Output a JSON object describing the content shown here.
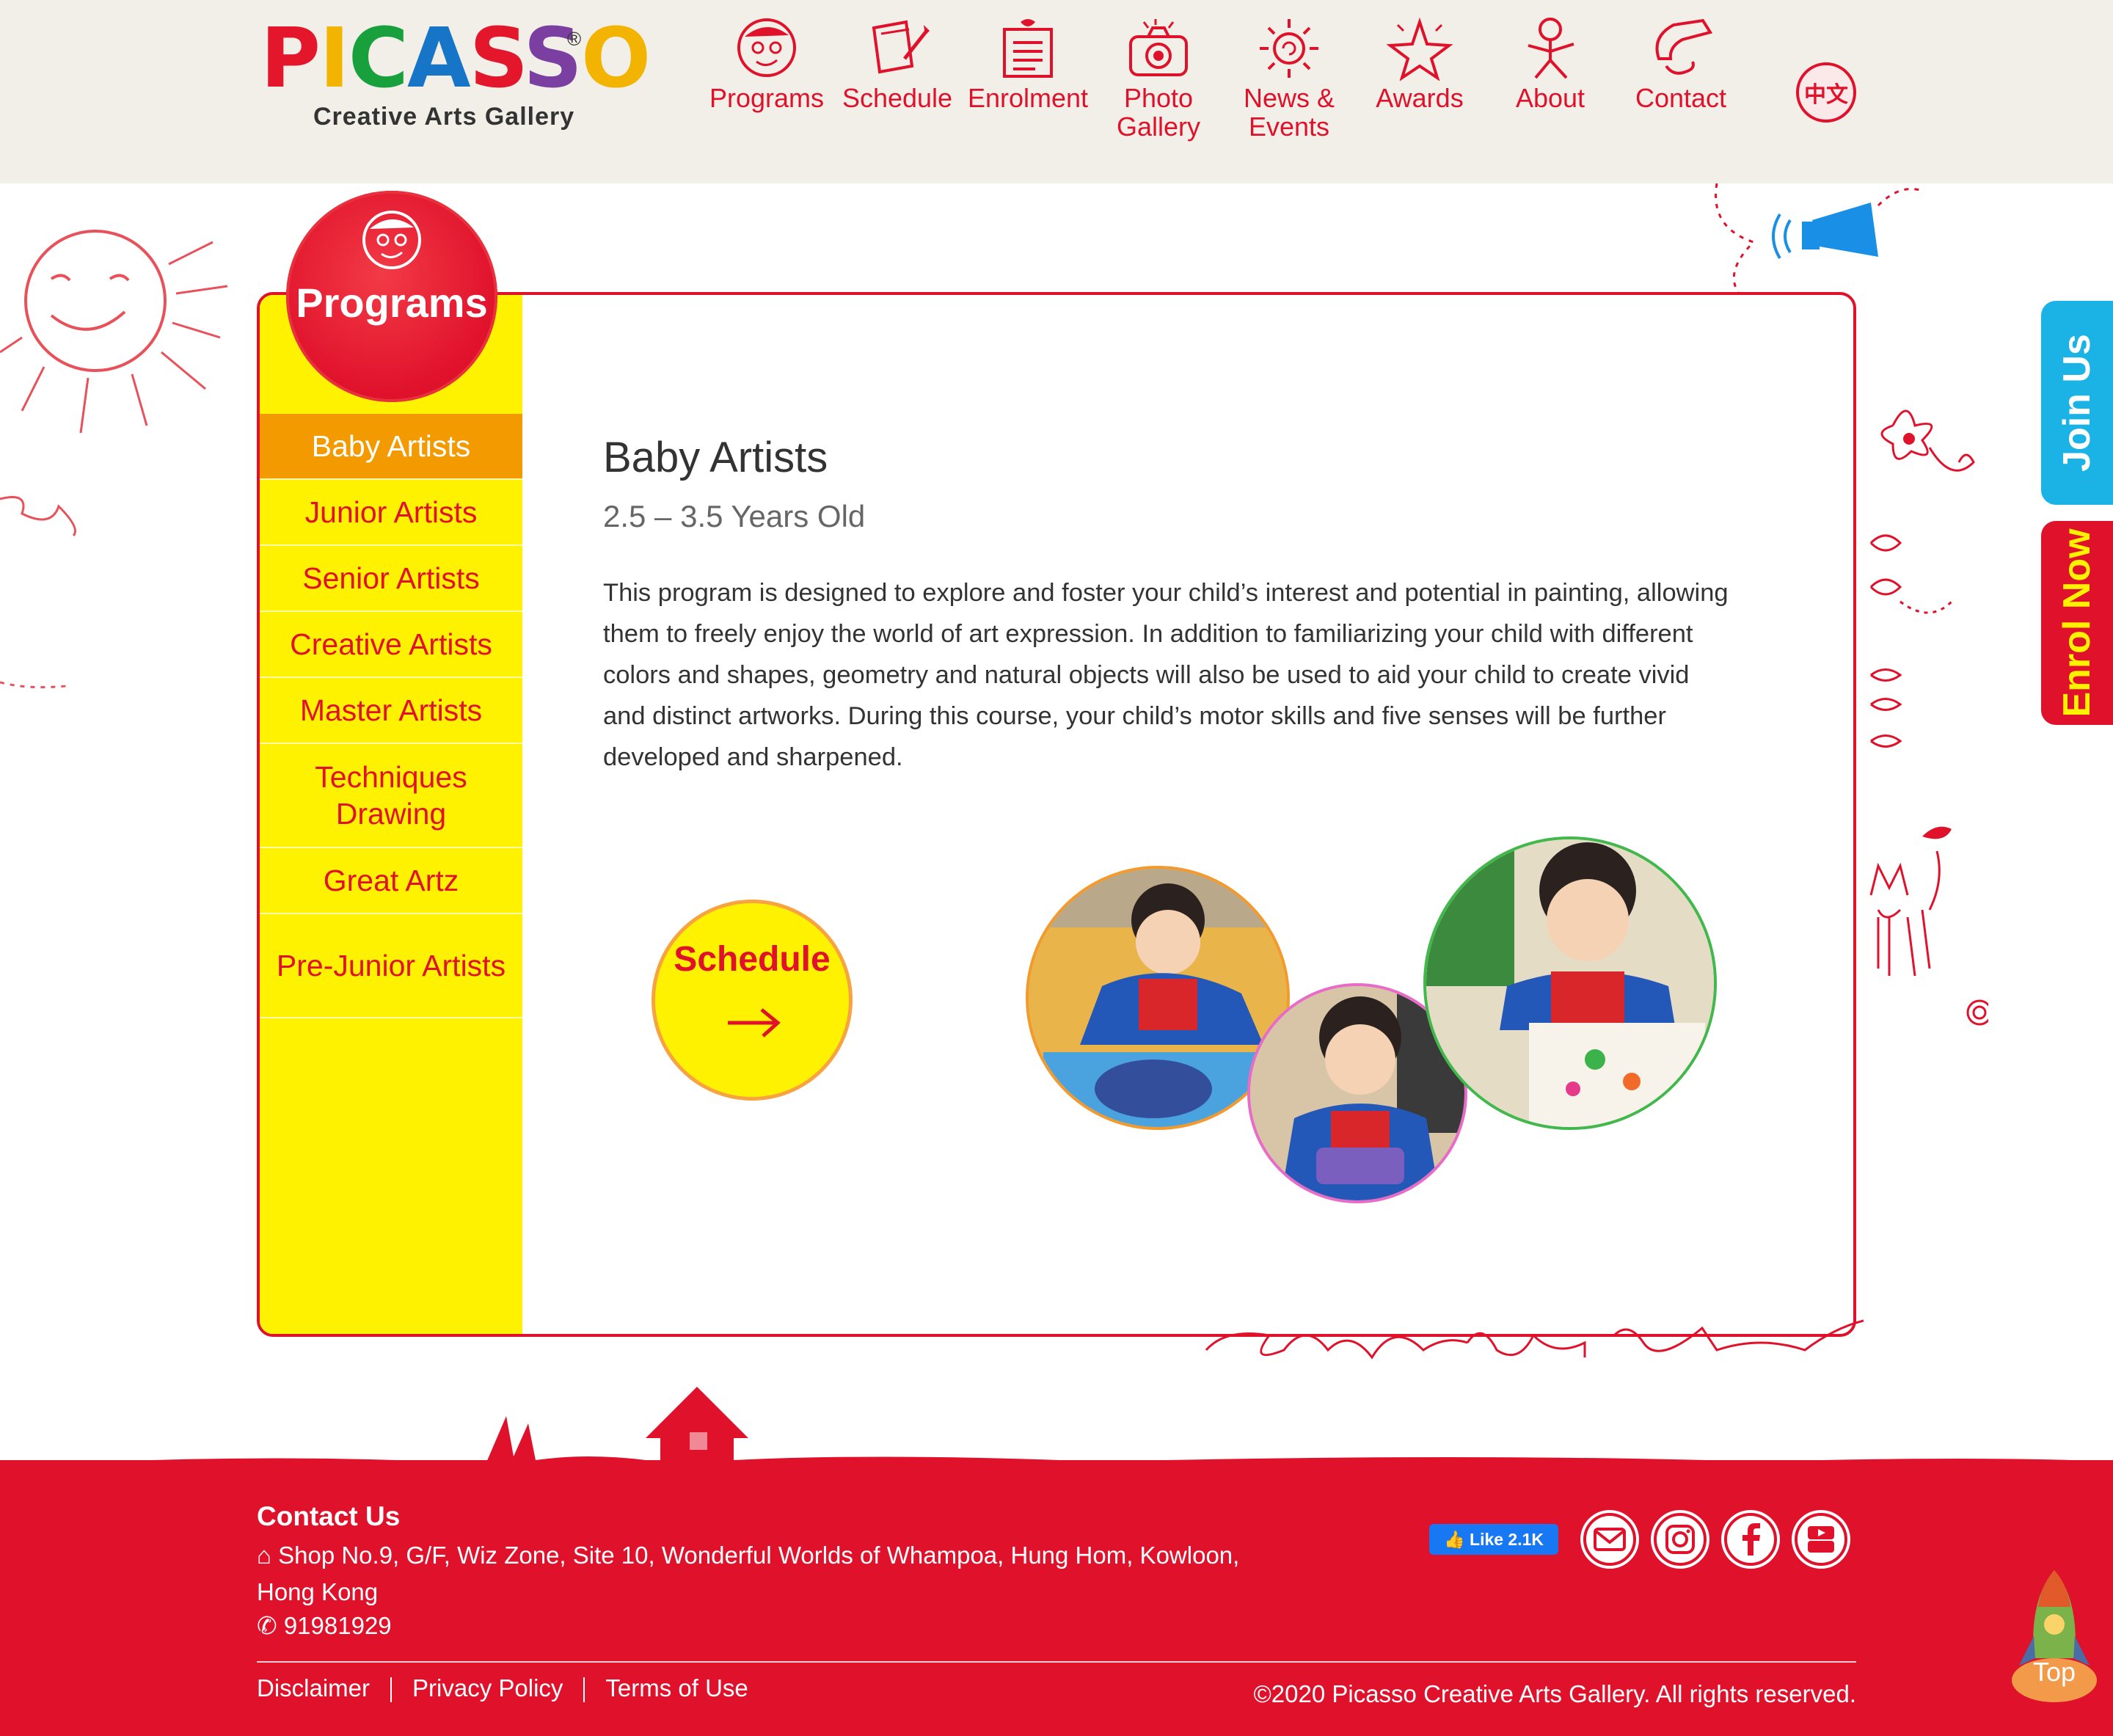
{
  "header": {
    "logo": {
      "word": [
        "P",
        "I",
        "C",
        "A",
        "S",
        "S",
        "O"
      ],
      "reg": "®",
      "sub": "Creative Arts Gallery"
    },
    "nav": [
      {
        "label": "Programs",
        "icon": "face-icon"
      },
      {
        "label": "Schedule",
        "icon": "paper-brush-icon"
      },
      {
        "label": "Enrolment",
        "icon": "gift-list-icon"
      },
      {
        "label": "Photo Gallery",
        "icon": "camera-icon"
      },
      {
        "label": "News & Events",
        "icon": "sun-icon"
      },
      {
        "label": "Awards",
        "icon": "star-icon"
      },
      {
        "label": "About",
        "icon": "person-icon"
      },
      {
        "label": "Contact",
        "icon": "phone-icon"
      }
    ],
    "lang": "中文"
  },
  "badge": {
    "label": "Programs"
  },
  "sidebar": {
    "items": [
      {
        "label": "Baby Artists",
        "active": true
      },
      {
        "label": "Junior Artists"
      },
      {
        "label": "Senior Artists"
      },
      {
        "label": "Creative Artists"
      },
      {
        "label": "Master Artists"
      },
      {
        "label": "Techniques Drawing"
      },
      {
        "label": "Great Artz"
      },
      {
        "label": "Pre-Junior Artists"
      }
    ]
  },
  "content": {
    "title": "Baby Artists",
    "age": "2.5 – 3.5 Years Old",
    "description": "This program is designed to explore and foster your child’s interest and potential in painting, allowing them to freely enjoy the world of art expression. In addition to familiarizing your child with different colors and shapes, geometry and natural objects will also be used to aid your child to create vivid and distinct artworks. During this course, your child’s motor skills  and five senses will be further developed and sharpened.",
    "schedule_button": "Schedule"
  },
  "side_tabs": {
    "join": "Join Us",
    "enrol": "Enrol Now"
  },
  "footer": {
    "heading": "Contact Us",
    "address": "Shop No.9, G/F, Wiz Zone, Site 10, Wonderful Worlds of Whampoa, Hung Hom, Kowloon, Hong Kong",
    "phone": "91981929",
    "links": [
      "Disclaimer",
      "Privacy Policy",
      "Terms of Use"
    ],
    "copyright": "©2020 Picasso Creative Arts Gallery. All rights reserved.",
    "fb_like": "Like 2.1K",
    "social": [
      "email-icon",
      "instagram-icon",
      "facebook-icon",
      "youtube-icon"
    ],
    "top": "Top"
  },
  "colors": {
    "brand_red": "#e0112b",
    "yellow": "#fff200",
    "orange": "#f29a00",
    "blue": "#1bb3e6"
  }
}
